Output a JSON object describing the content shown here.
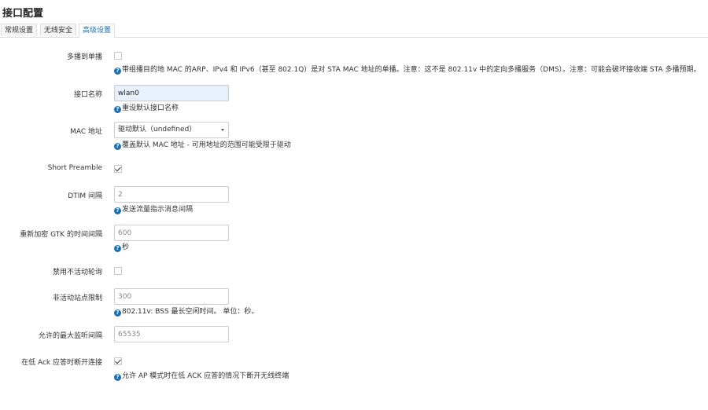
{
  "section": {
    "title": "接口配置"
  },
  "tabs": [
    {
      "label": "常规设置",
      "active": false
    },
    {
      "label": "无线安全",
      "active": false
    },
    {
      "label": "高级设置",
      "active": true
    }
  ],
  "icons": {
    "help": "question-circle-icon",
    "checkmark": "checkmark-icon",
    "dropdown": "caret-down-icon"
  },
  "colors": {
    "accent": "#1b6fb5",
    "autofill": "#e8f0fe"
  },
  "fields": {
    "multicast_to_unicast": {
      "label": "多播到单播",
      "checked": false,
      "help": "带组播目的地 MAC 的ARP、IPv4 和 IPv6（甚至 802.1Q）是对 STA MAC 地址的单播。注意：这不是 802.11v 中的定向多播服务（DMS）。注意：可能会破坏接收端 STA 多播预期。"
    },
    "ifname": {
      "label": "接口名称",
      "value": "wlan0",
      "help": "重设默认接口名称"
    },
    "macaddr": {
      "label": "MAC 地址",
      "selected": "驱动默认（undefined）",
      "help": "覆盖默认 MAC 地址 - 可用地址的范围可能受限于驱动"
    },
    "short_preamble": {
      "label": "Short Preamble",
      "checked": true
    },
    "dtim_period": {
      "label": "DTIM 间隔",
      "placeholder": "2",
      "help": "发送流量指示消息间隔"
    },
    "gtk_rekey": {
      "label": "重新加密 GTK 的时间间隔",
      "placeholder": "600",
      "help": "秒"
    },
    "disable_inactivity_poll": {
      "label": "禁用不活动轮询",
      "checked": false
    },
    "max_inactivity": {
      "label": "非活动站点限制",
      "placeholder": "300",
      "help": "802.11v: BSS 最长空闲时间。 单位：秒。"
    },
    "max_listen_int": {
      "label": "允许的最大监听间隔",
      "placeholder": "65535"
    },
    "disassoc_low_ack": {
      "label": "在低 Ack 应答时断开连接",
      "checked": true,
      "help": "允许 AP 模式时在低 ACK 应答的情况下断开无线终端"
    }
  }
}
